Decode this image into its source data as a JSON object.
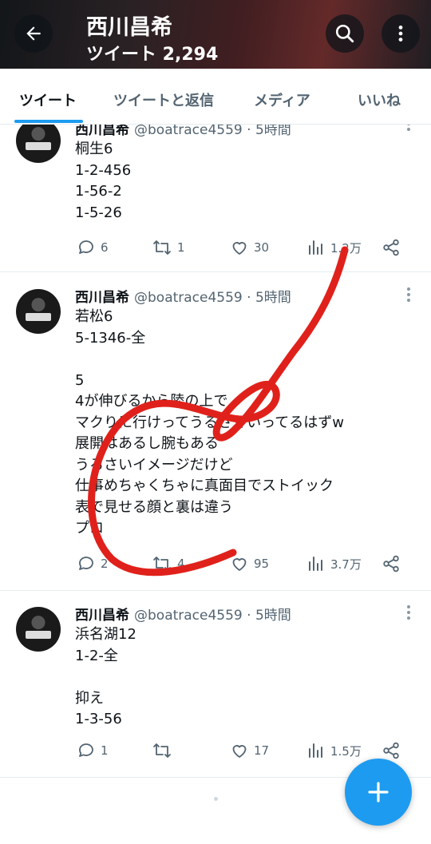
{
  "header": {
    "title": "西川昌希",
    "subtitle": "ツイート 2,294",
    "back_icon": "arrow-left-icon",
    "search_icon": "search-icon",
    "more_icon": "more-vertical-icon"
  },
  "tabs": [
    {
      "label": "ツイート",
      "active": true
    },
    {
      "label": "ツイートと返信",
      "active": false
    },
    {
      "label": "メディア",
      "active": false
    },
    {
      "label": "いいね",
      "active": false
    }
  ],
  "tweets": [
    {
      "name": "西川昌希",
      "handle": "@boatrace4559 · 5時間",
      "lines": [
        "桐生6",
        "1-2-456",
        "1-56-2",
        "1-5-26"
      ],
      "replies": "6",
      "retweets": "1",
      "likes": "30",
      "views": "1.2万"
    },
    {
      "name": "西川昌希",
      "handle": "@boatrace4559 · 5時間",
      "lines": [
        "若松6",
        "5-1346-全",
        "",
        "5",
        "4が伸びるから陸の上で",
        "マクりに行けってうるさくいってるはずw",
        "展開はあるし腕もある",
        "うるさいイメージだけど",
        "仕事めちゃくちゃに真面目でストイック",
        "表で見せる顔と裏は違う",
        "プロ"
      ],
      "replies": "2",
      "retweets": "4",
      "likes": "95",
      "views": "3.7万"
    },
    {
      "name": "西川昌希",
      "handle": "@boatrace4559 · 5時間",
      "lines": [
        "浜名湖12",
        "1-2-全",
        "",
        "抑え",
        "1-3-56"
      ],
      "replies": "1",
      "retweets": "",
      "likes": "17",
      "views": "1.5万"
    }
  ],
  "colors": {
    "accent": "#1d9bf0",
    "annotation": "#e0211b",
    "secondary_text": "#536471"
  },
  "fab": {
    "icon": "plus-icon"
  }
}
